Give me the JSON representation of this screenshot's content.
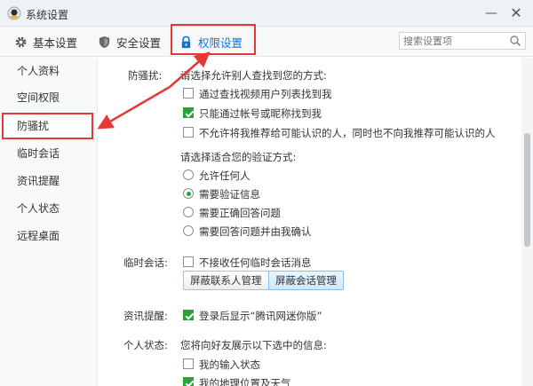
{
  "window": {
    "title": "系统设置",
    "minimize_glyph": "—",
    "close_glyph": "✕"
  },
  "tabs": [
    {
      "label": "基本设置",
      "icon": "gear-icon"
    },
    {
      "label": "安全设置",
      "icon": "shield-icon"
    },
    {
      "label": "权限设置",
      "icon": "lock-icon",
      "active": true
    }
  ],
  "search": {
    "placeholder": "搜索设置项",
    "icon": "search-icon"
  },
  "sidebar": {
    "items": [
      {
        "label": "个人资料"
      },
      {
        "label": "空间权限"
      },
      {
        "label": "防骚扰",
        "active": true
      },
      {
        "label": "临时会话"
      },
      {
        "label": "资讯提醒"
      },
      {
        "label": "个人状态"
      },
      {
        "label": "远程桌面"
      }
    ]
  },
  "content": {
    "harass": {
      "label": "防骚扰:",
      "find_prompt": "请选择允许别人查找到您的方式:",
      "find_options": [
        {
          "text": "通过查找视频用户列表找到我",
          "checked": false
        },
        {
          "text": "只能通过帐号或昵称找到我",
          "checked": true
        },
        {
          "text": "不允许将我推荐给可能认识的人，同时也不向我推荐可能认识的人",
          "checked": false
        }
      ],
      "verify_prompt": "请选择适合您的验证方式:",
      "verify_options": [
        {
          "text": "允许任何人",
          "selected": false
        },
        {
          "text": "需要验证信息",
          "selected": true
        },
        {
          "text": "需要正确回答问题",
          "selected": false
        },
        {
          "text": "需要回答问题并由我确认",
          "selected": false
        }
      ]
    },
    "temp_chat": {
      "label": "临时会话:",
      "option": {
        "text": "不接收任何临时会话消息",
        "checked": false
      },
      "buttons": [
        "屏蔽联系人管理",
        "屏蔽会话管理"
      ]
    },
    "news": {
      "label": "资讯提醒:",
      "option": {
        "text": "登录后显示“腾讯网迷你版”",
        "checked": true
      }
    },
    "status": {
      "label": "个人状态:",
      "prompt": "您将向好友展示以下选中的信息:",
      "options": [
        {
          "text": "我的输入状态",
          "checked": false
        },
        {
          "text": "我的地理位置及天气",
          "checked": true
        }
      ]
    }
  },
  "annotations": {
    "color": "#e53935"
  }
}
